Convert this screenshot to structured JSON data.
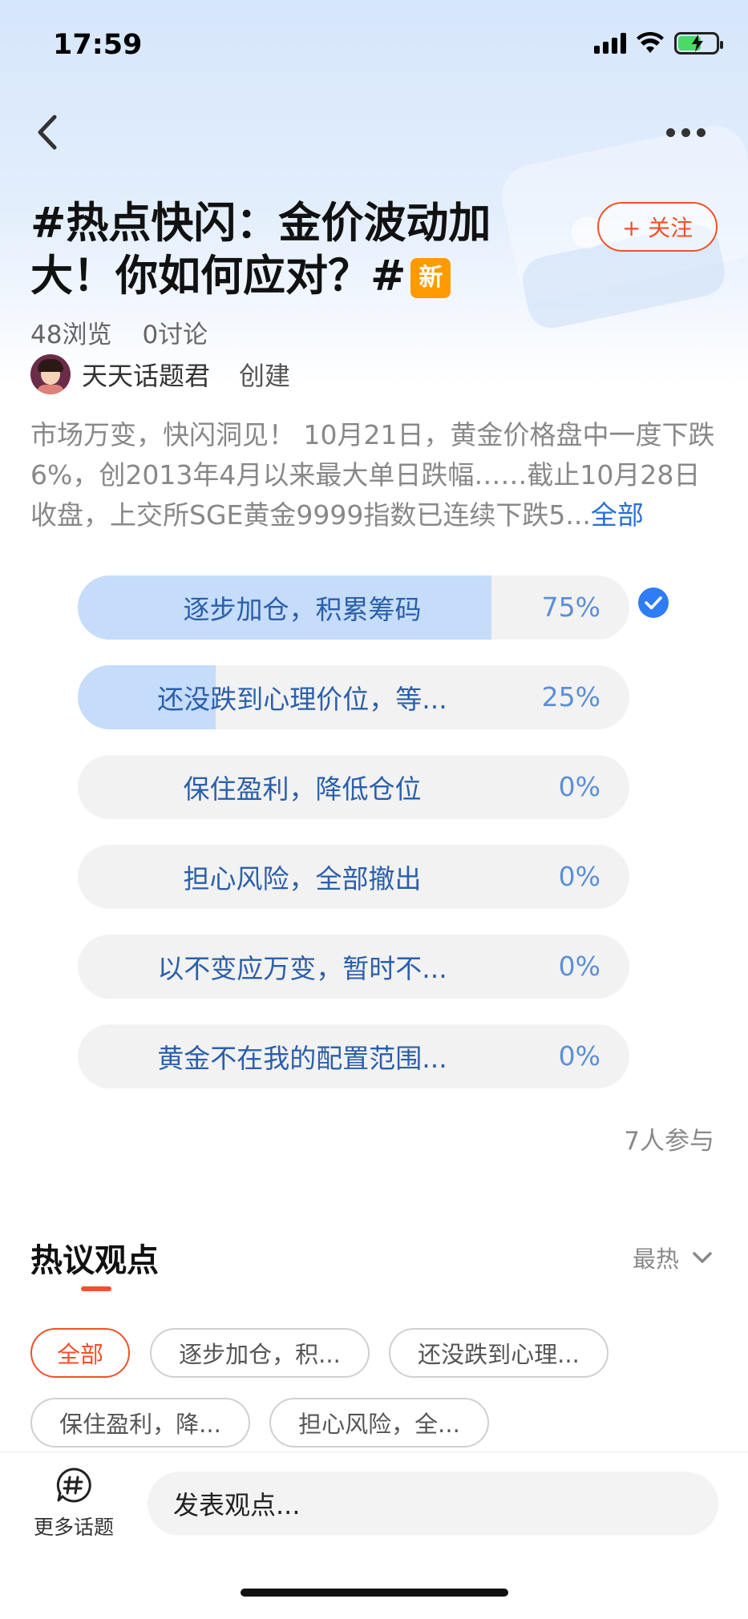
{
  "status_bar": {
    "time": "17:59"
  },
  "topic": {
    "title": "#热点快闪：金价波动加大！你如何应对？#",
    "badge": "新",
    "follow_label": "+ 关注",
    "views": "48浏览",
    "discussions": "0讨论",
    "creator_name": "天天话题君",
    "creator_action": "创建",
    "description": "市场万变，快闪洞见！ 10月21日，黄金价格盘中一度下跌6%，创2013年4月以来最大单日跌幅……截止10月28日收盘，上交所SGE黄金9999指数已连续下跌5...",
    "description_more": "全部"
  },
  "poll": {
    "options": [
      {
        "label": "逐步加仓，积累筹码",
        "percent": "75%",
        "value": 0.75,
        "selected": true
      },
      {
        "label": "还没跌到心理价位，等...",
        "percent": "25%",
        "value": 0.25,
        "selected": false
      },
      {
        "label": "保住盈利，降低仓位",
        "percent": "0%",
        "value": 0,
        "selected": false
      },
      {
        "label": "担心风险，全部撤出",
        "percent": "0%",
        "value": 0,
        "selected": false
      },
      {
        "label": "以不变应万变，暂时不...",
        "percent": "0%",
        "value": 0,
        "selected": false
      },
      {
        "label": "黄金不在我的配置范围...",
        "percent": "0%",
        "value": 0,
        "selected": false
      }
    ],
    "participants": "7人参与"
  },
  "opinions": {
    "title": "热议观点",
    "sort_label": "最热",
    "chips": [
      "全部",
      "逐步加仓，积...",
      "还没跌到心理...",
      "保住盈利，降...",
      "担心风险，全..."
    ]
  },
  "bottom_bar": {
    "more_topics_label": "更多话题",
    "input_placeholder": "发表观点..."
  },
  "colors": {
    "accent": "#f2502a",
    "poll_fill": "#c5dcfa",
    "poll_text": "#2b5fab",
    "new_badge": "#ff9a00",
    "check": "#2e7cf6"
  },
  "icons": {
    "back": "back-arrow-icon",
    "more": "more-dots-icon",
    "wifi": "wifi-icon",
    "signal": "signal-icon",
    "battery": "battery-charging-icon",
    "check": "check-circle-icon",
    "chevron": "chevron-down-icon",
    "topic": "hashtag-bubble-icon"
  }
}
